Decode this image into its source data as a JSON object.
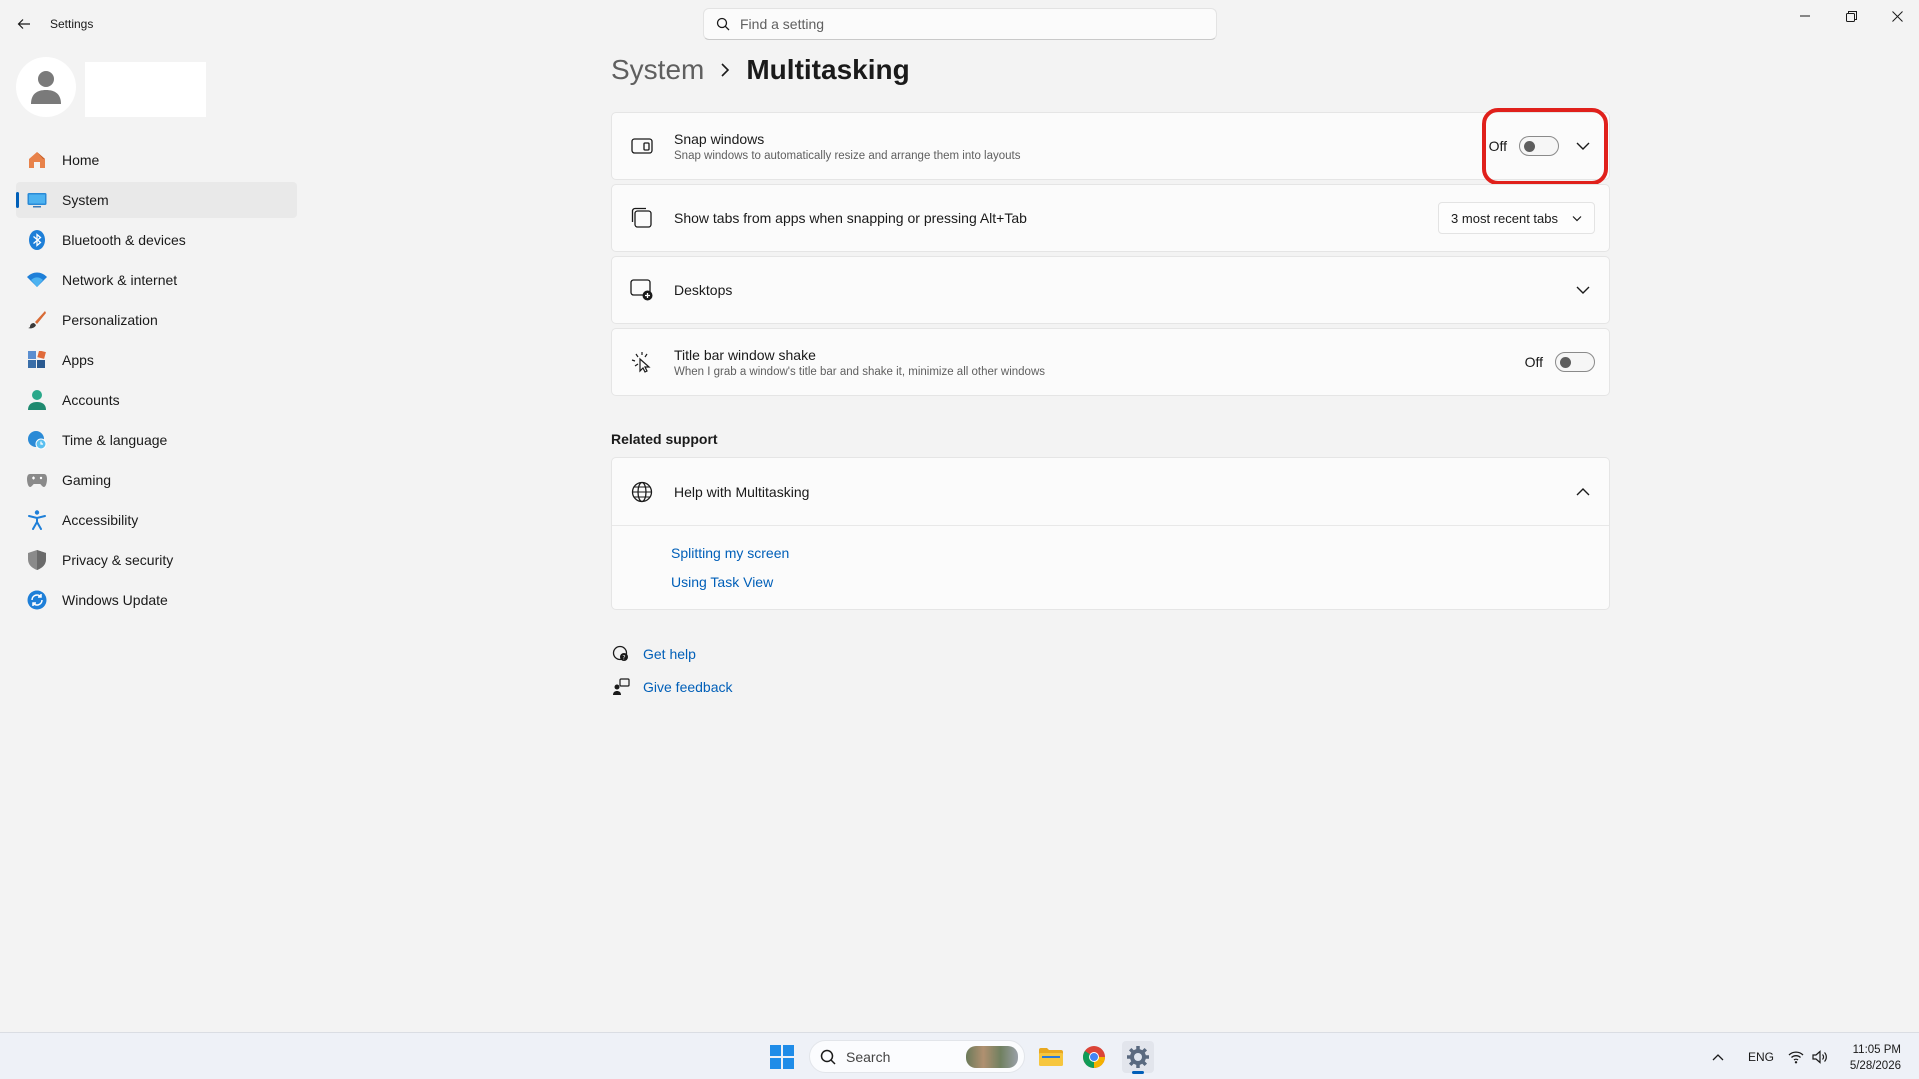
{
  "window": {
    "title": "Settings"
  },
  "search": {
    "placeholder": "Find a setting"
  },
  "sidebar": {
    "items": [
      {
        "label": "Home",
        "icon": "home-icon"
      },
      {
        "label": "System",
        "icon": "system-icon",
        "active": true
      },
      {
        "label": "Bluetooth & devices",
        "icon": "bluetooth-icon"
      },
      {
        "label": "Network & internet",
        "icon": "wifi-icon"
      },
      {
        "label": "Personalization",
        "icon": "brush-icon"
      },
      {
        "label": "Apps",
        "icon": "apps-icon"
      },
      {
        "label": "Accounts",
        "icon": "accounts-icon"
      },
      {
        "label": "Time & language",
        "icon": "globe-clock-icon"
      },
      {
        "label": "Gaming",
        "icon": "gamepad-icon"
      },
      {
        "label": "Accessibility",
        "icon": "accessibility-icon"
      },
      {
        "label": "Privacy & security",
        "icon": "shield-icon"
      },
      {
        "label": "Windows Update",
        "icon": "update-icon"
      }
    ]
  },
  "breadcrumb": {
    "parent": "System",
    "current": "Multitasking"
  },
  "settings": {
    "snap_windows": {
      "title": "Snap windows",
      "description": "Snap windows to automatically resize and arrange them into layouts",
      "state_label": "Off"
    },
    "show_tabs": {
      "title": "Show tabs from apps when snapping or pressing Alt+Tab",
      "selected": "3 most recent tabs"
    },
    "desktops": {
      "title": "Desktops"
    },
    "title_bar_shake": {
      "title": "Title bar window shake",
      "description": "When I grab a window's title bar and shake it, minimize all other windows",
      "state_label": "Off"
    }
  },
  "related_support": {
    "heading": "Related support",
    "help_title": "Help with Multitasking",
    "links": [
      "Splitting my screen",
      "Using Task View"
    ]
  },
  "footer": {
    "get_help": "Get help",
    "give_feedback": "Give feedback"
  },
  "taskbar": {
    "search_label": "Search",
    "language": "ENG",
    "time": "11:05 PM",
    "date": "5/28/2026"
  },
  "colors": {
    "accent": "#005fb8",
    "highlight": "#e0201b",
    "background": "#f3f3f3"
  }
}
